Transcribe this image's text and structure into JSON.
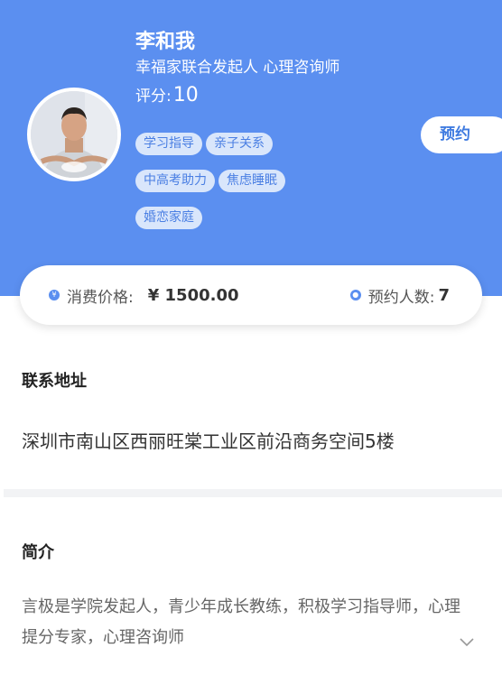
{
  "profile": {
    "name": "李和我",
    "title": "幸福家联合发起人 心理咨询师",
    "rating_label": "评分:",
    "rating_value": "10",
    "tags": [
      "学习指导",
      "亲子关系",
      "中高考助力",
      "焦虑睡眠",
      "婚恋家庭"
    ],
    "book_label": "预约"
  },
  "stats": {
    "price_label": "消费价格:",
    "price_value": "¥ 1500.00",
    "count_label": "预约人数:",
    "count_value": "7"
  },
  "address": {
    "heading": "联系地址",
    "text": "深圳市南山区西丽旺棠工业区前沿商务空间5楼"
  },
  "intro": {
    "heading": "简介",
    "text": "言极是学院发起人，青少年成长教练，积极学习指导师，心理提分专家，心理咨询师"
  },
  "colors": {
    "header_bg": "#5b8ff0",
    "accent": "#3f7be0",
    "tag_bg": "#d9e6fb"
  },
  "icons": {
    "price": "yen-circle-icon",
    "count": "person-circle-icon",
    "expand": "chevron-down-icon"
  }
}
